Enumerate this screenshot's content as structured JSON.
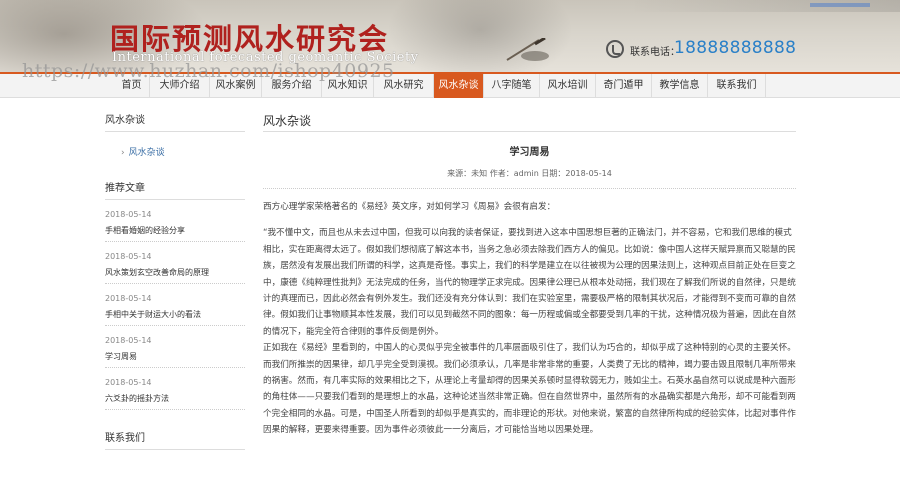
{
  "header": {
    "logo_cn": "国际预测风水研究会",
    "logo_en": "International forecasted geomantic Society",
    "phone_label": "联系电话：",
    "phone_number": "18888888888",
    "watermark": "https://www.huzhan.com/ishop40925"
  },
  "nav": {
    "items": [
      "首页",
      "大师介绍",
      "风水案例",
      "服务介绍",
      "风水知识",
      "风水研究",
      "风水杂谈",
      "八字随笔",
      "风水培训",
      "奇门遁甲",
      "教学信息",
      "联系我们"
    ],
    "active_index": 6
  },
  "sidebar": {
    "category_title": "风水杂谈",
    "category_item": "风水杂谈",
    "recommend_title": "推荐文章",
    "recommend": [
      {
        "date": "2018-05-14",
        "title": "手相看婚姻的经验分享"
      },
      {
        "date": "2018-05-14",
        "title": "风水策划玄空改善命局的原理"
      },
      {
        "date": "2018-05-14",
        "title": "手相中关于财运大小的看法"
      },
      {
        "date": "2018-05-14",
        "title": "学习周易"
      },
      {
        "date": "2018-05-14",
        "title": "六爻卦的摇卦方法"
      }
    ],
    "contact_title": "联系我们"
  },
  "main": {
    "section_title": "风水杂谈",
    "article_title": "学习周易",
    "meta": "来源：未知 作者：admin 日期：2018-05-14",
    "paragraphs": [
      "西方心理学家荣格著名的《易经》英文序，对如何学习《周易》会很有启发：",
      "“我不懂中文，而且也从未去过中国，但我可以向我的读者保证，要找到进入这本中国思想巨著的正确法门，并不容易，它和我们思维的模式相比，实在距离得太远了。假如我们想彻底了解这本书，当务之急必须去除我们西方人的偏见。比如说：像中国人这样天赋异禀而又聪慧的民族，居然没有发展出我们所谓的科学，这真是奇怪。事实上，我们的科学是建立在以往被视为公理的因果法则上，这种观点目前正处在巨变之中，康德《纯粹理性批判》无法完成的任务，当代的物理学正求完成。因果律公理已从根本处动摇，我们现在了解我们所说的自然律，只是统计的真理而已，因此必然会有例外发生。我们还没有充分体认到：我们在实验室里，需要极严格的限制其状况后，才能得到不变而可靠的自然律。假如我们让事物顺其本性发展，我们可以见到截然不同的图象：每一历程或偏或全都要受到几率的干扰，这种情况极为普遍，因此在自然的情况下，能完全符合律则的事件反倒是例外。",
      "正如我在《易经》里看到的，中国人的心灵似乎完全被事件的几率层面吸引住了，我们认为巧合的，却似乎成了这种特别的心灵的主要关怀。而我们所推崇的因果律，却几乎完全受到漠视。我们必须承认，几率是非常非常的重要，人类费了无比的精神，竭力要击毁且限制几率所带来的祸害。然而，有几率实际的效果相比之下，从理论上考量却得的因果关系顿时显得软弱无力，贱如尘土。石英水晶自然可以说成是种六面形的角柱体——只要我们看到的是理想上的水晶，这种论述当然非常正确。但在自然世界中，虽然所有的水晶确实都是六角形，却不可能看到两个完全相同的水晶。可是，中国圣人所看到的却似乎是真实的，而非理论的形状。对他来说，繁富的自然律所构成的经验实体，比起对事件作因果的解释，更要来得重要。因为事件必须彼此一一分离后，才可能恰当地以因果处理。"
    ]
  }
}
